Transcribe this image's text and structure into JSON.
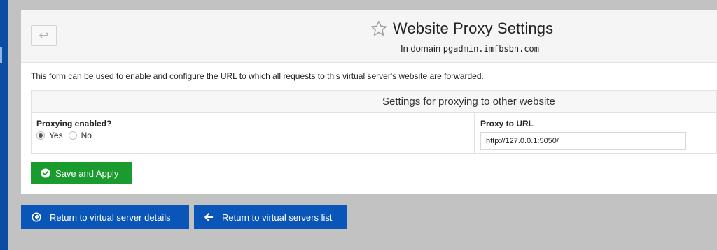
{
  "page": {
    "title": "Website Proxy Settings",
    "subtitle_prefix": "In domain",
    "domain": "pgadmin.imfbsbn.com",
    "description": "This form can be used to enable and configure the URL to which all requests to this virtual server's website are forwarded."
  },
  "settings": {
    "section_title": "Settings for proxying to other website",
    "proxying_label": "Proxying enabled?",
    "options": [
      "Yes",
      "No"
    ],
    "selected_option": "Yes",
    "proxy_url_label": "Proxy to URL",
    "proxy_url_value": "http://127.0.0.1:5050/"
  },
  "actions": {
    "save_label": "Save and Apply",
    "return_details_label": "Return to virtual server details",
    "return_list_label": "Return to virtual servers list"
  },
  "icons": {
    "back": "arrow-return-icon",
    "favorite": "star-outline-icon",
    "save": "check-circle-icon",
    "return_details": "circle-arrow-left-icon",
    "return_list": "arrow-left-icon"
  },
  "colors": {
    "sidebar": "#0a4da3",
    "save_button": "#1a9b2e",
    "nav_button": "#0a56b8",
    "background": "#c2c2c2"
  }
}
